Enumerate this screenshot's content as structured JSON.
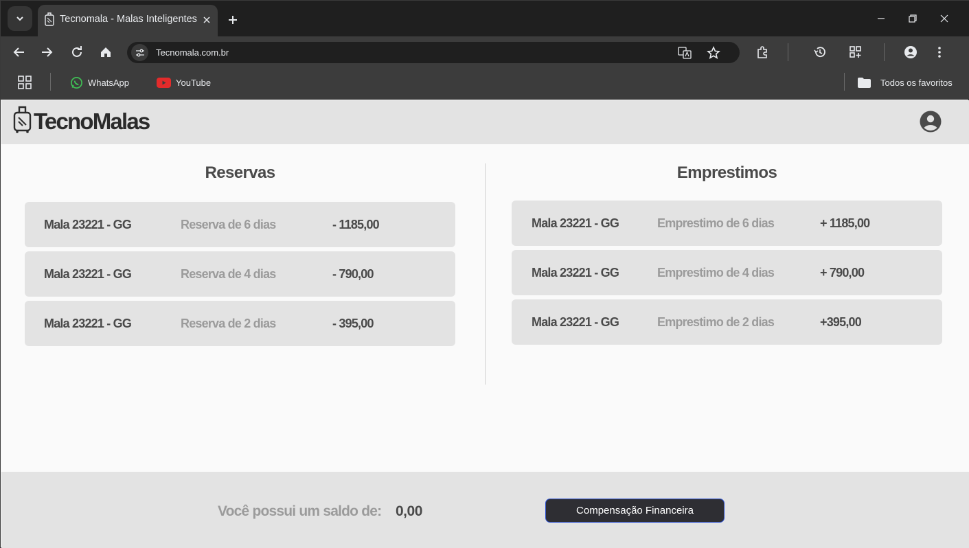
{
  "browser": {
    "tab_title": "Tecnomala - Malas Inteligentes",
    "url": "Tecnomala.com.br",
    "bookmarks": [
      {
        "label": "WhatsApp",
        "icon": "whatsapp-icon"
      },
      {
        "label": "YouTube",
        "icon": "youtube-icon"
      }
    ],
    "all_bookmarks_label": "Todos os favoritos"
  },
  "site": {
    "brand": "TecnoMalas",
    "reservas": {
      "title": "Reservas",
      "items": [
        {
          "item": "Mala 23221 - GG",
          "desc": "Reserva de 6 dias",
          "value": "- 1185,00"
        },
        {
          "item": "Mala 23221 - GG",
          "desc": "Reserva de 4 dias",
          "value": "- 790,00"
        },
        {
          "item": "Mala 23221 - GG",
          "desc": "Reserva de 2 dias",
          "value": "- 395,00"
        }
      ]
    },
    "emprestimos": {
      "title": "Emprestimos",
      "items": [
        {
          "item": "Mala 23221 - GG",
          "desc": "Emprestimo de 6 dias",
          "value": "+ 1185,00"
        },
        {
          "item": "Mala 23221 - GG",
          "desc": "Emprestimo de 4 dias",
          "value": "+ 790,00"
        },
        {
          "item": "Mala 23221 - GG",
          "desc": "Emprestimo de 2 dias",
          "value": "+395,00"
        }
      ]
    },
    "footer": {
      "balance_label": "Você possui um saldo de:",
      "balance_value": "0,00",
      "button_label": "Compensação Financeira"
    }
  },
  "colors": {
    "header_bg": "#e3e3e3",
    "card_bg": "#e3e3e3",
    "button_bg": "#2e2e33",
    "button_border": "#2a4fd1"
  }
}
